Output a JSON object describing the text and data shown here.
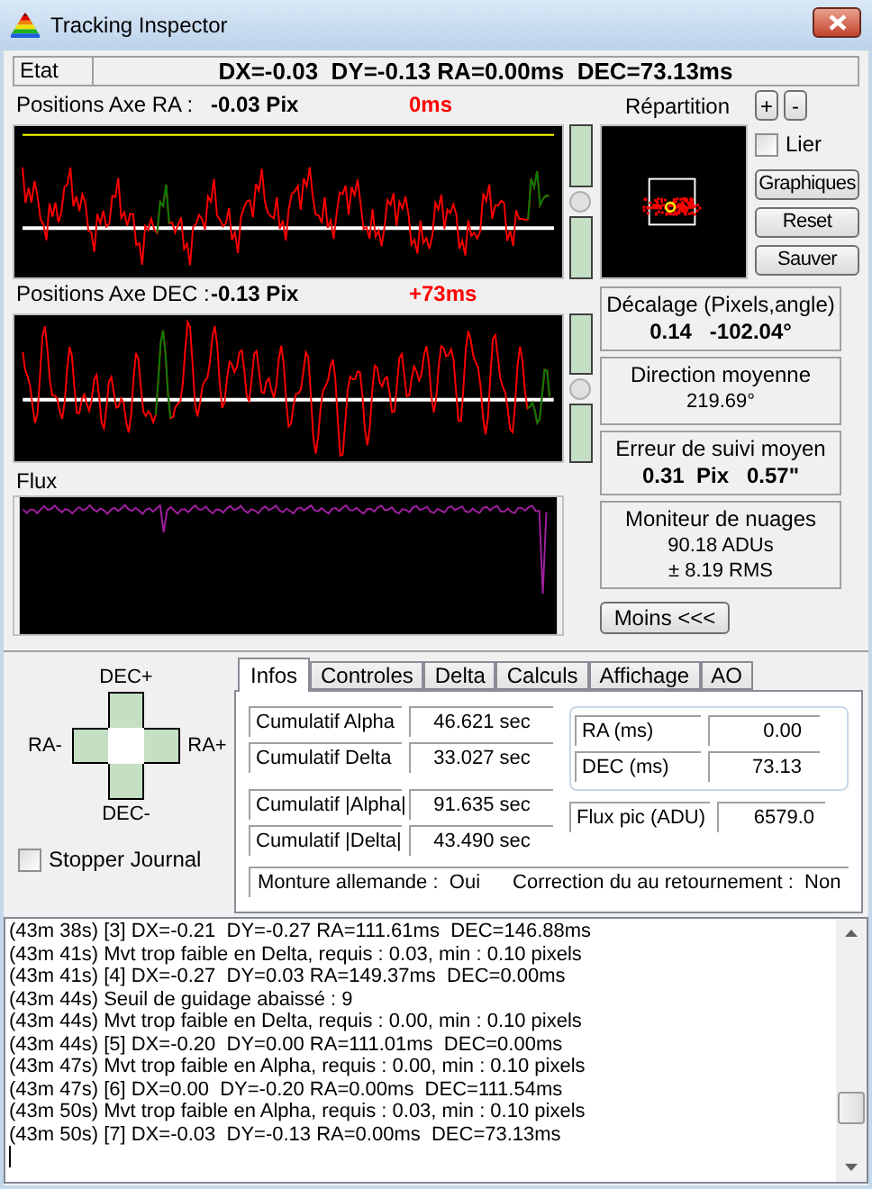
{
  "window": {
    "title": "Tracking Inspector"
  },
  "status": {
    "label": "Etat",
    "text": "DX=-0.03  DY=-0.13 RA=0.00ms  DEC=73.13ms"
  },
  "ra_axis": {
    "label": "Positions Axe RA :",
    "pixels": "-0.03 Pix",
    "correction": "0ms"
  },
  "distribution": {
    "label": "Répartition"
  },
  "zoom_buttons": [
    "+",
    "-"
  ],
  "link_checkbox": {
    "label": "Lier",
    "checked": false
  },
  "buttons": [
    "Graphiques",
    "Reset",
    "Sauver"
  ],
  "dec_axis": {
    "label": "Positions Axe DEC :",
    "pixels": "-0.13 Pix",
    "correction": "+73ms"
  },
  "flux": {
    "label": "Flux"
  },
  "stats": [
    {
      "title": "Décalage (Pixels,angle)",
      "kind": "emphasis",
      "lines": [
        "0.14   -102.04°"
      ]
    },
    {
      "title": "Direction moyenne",
      "kind": "normal",
      "lines": [
        "219.69°"
      ]
    },
    {
      "title": "Erreur de suivi moyen",
      "kind": "emphasis",
      "lines": [
        "0.31  Pix   0.57\""
      ]
    },
    {
      "title": "Moniteur de nuages",
      "kind": "normal",
      "lines": [
        "90.18 ADUs",
        "± 8.19 RMS"
      ]
    }
  ],
  "less_button": "Moins <<<",
  "pad": {
    "up": "DEC+",
    "down": "DEC-",
    "left": "RA-",
    "right": "RA+"
  },
  "stop_log": {
    "label": "Stopper Journal",
    "checked": false
  },
  "tabs": [
    {
      "label": "Infos",
      "selected": true
    },
    {
      "label": "Controles",
      "selected": false
    },
    {
      "label": "Delta",
      "selected": false
    },
    {
      "label": "Calculs",
      "selected": false
    },
    {
      "label": "Affichage",
      "selected": false
    },
    {
      "label": "AO",
      "selected": false
    }
  ],
  "cumulative": [
    {
      "label": "Cumulatif Alpha",
      "value": "46.621 sec"
    },
    {
      "label": "Cumulatif Delta",
      "value": "33.027 sec"
    },
    {
      "label": "Cumulatif |Alpha|",
      "value": "91.635 sec"
    },
    {
      "label": "Cumulatif |Delta|",
      "value": "43.490 sec"
    }
  ],
  "corrections": [
    {
      "label": "RA (ms)",
      "value": "0.00"
    },
    {
      "label": "DEC (ms)",
      "value": "73.13"
    }
  ],
  "peak_flux": {
    "label": "Flux pic (ADU)",
    "value": "6579.0"
  },
  "mount": {
    "german": "Monture allemande :  Oui",
    "flip": "Correction du au retournement :  Non"
  },
  "log": [
    "(43m 38s) [3] DX=-0.21  DY=-0.27 RA=111.61ms  DEC=146.88ms",
    "(43m 41s) Mvt trop faible en Delta, requis : 0.03, min : 0.10 pixels",
    "(43m 41s) [4] DX=-0.27  DY=0.03 RA=149.37ms  DEC=0.00ms",
    "(43m 44s) Seuil de guidage abaissé : 9",
    "(43m 44s) Mvt trop faible en Delta, requis : 0.00, min : 0.10 pixels",
    "(43m 44s) [5] DX=-0.20  DY=0.00 RA=111.01ms  DEC=0.00ms",
    "(43m 47s) Mvt trop faible en Alpha, requis : 0.00, min : 0.10 pixels",
    "(43m 47s) [6] DX=0.00  DY=-0.20 RA=0.00ms  DEC=111.54ms",
    "(43m 50s) Mvt trop faible en Alpha, requis : 0.03, min : 0.10 pixels",
    "(43m 50s) [7] DX=-0.03  DY=-0.13 RA=0.00ms  DEC=73.13ms"
  ]
}
